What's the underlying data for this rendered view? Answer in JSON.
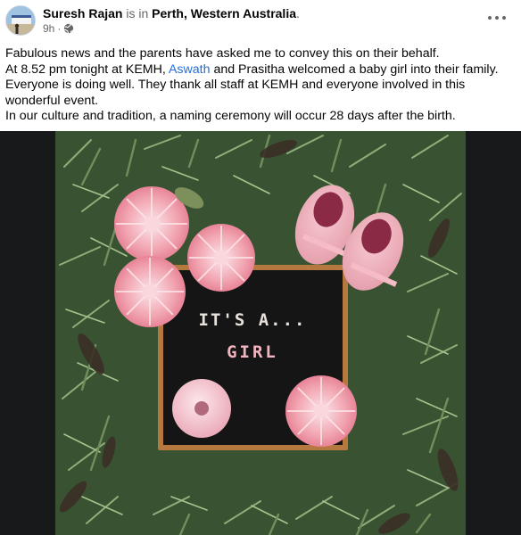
{
  "post": {
    "author": "Suresh Rajan",
    "is_in": "is in",
    "location": "Perth, Western Australia",
    "location_period": ".",
    "time": "9h",
    "time_sep": "·",
    "privacy_icon": "globe-icon",
    "more_icon": "more-horizontal-icon",
    "text": {
      "line1": "Fabulous news and the parents have asked me to convey this on their behalf.",
      "line2_before": "At 8.52 pm tonight at KEMH, ",
      "mention": "Aswath",
      "line2_after": " and Prasitha welcomed a baby girl into their family.",
      "line3": "Everyone is doing well. They thank all staff at KEMH and everyone involved in this wonderful event.",
      "line4": "In our culture and tradition, a naming ceremony will occur 28 days after the birth."
    }
  },
  "photo": {
    "board_line1": "IT'S A...",
    "board_line2": "GIRL"
  },
  "colors": {
    "link": "#216fdb",
    "secondary_text": "#65676b",
    "media_background": "#18191a",
    "letter_board": "#151515",
    "board_frame": "#b5783f",
    "board_line2_text": "#f2b5be"
  }
}
